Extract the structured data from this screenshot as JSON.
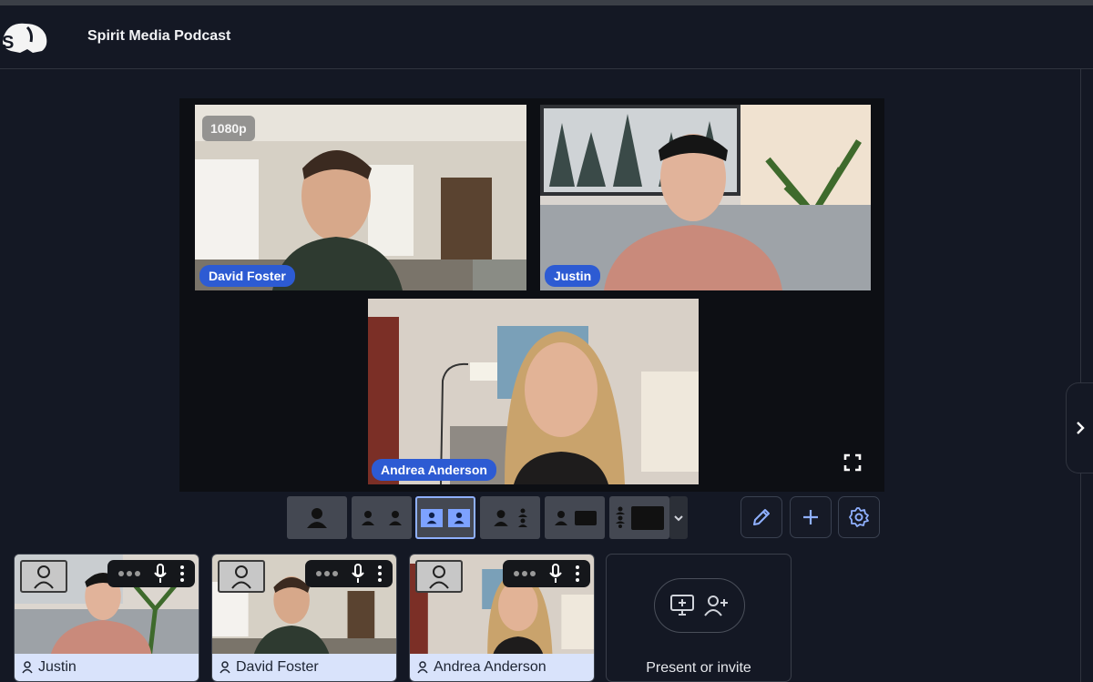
{
  "app": {
    "title": "Spirit Media Podcast",
    "logo_letter": "S"
  },
  "stage": {
    "resolution_badge": "1080p",
    "participants": [
      {
        "name": "David Foster"
      },
      {
        "name": "Justin"
      },
      {
        "name": "Andrea Anderson"
      }
    ]
  },
  "layout_options": [
    "single",
    "two-side-by-side",
    "two-side-by-side-selected",
    "one-plus-two",
    "one-plus-screen",
    "list-plus-screen"
  ],
  "selected_layout_index": 2,
  "thumbnails": [
    {
      "name": "Justin"
    },
    {
      "name": "David Foster"
    },
    {
      "name": "Andrea Anderson"
    }
  ],
  "invite": {
    "label": "Present or invite"
  },
  "colors": {
    "accent": "#2d5bd3",
    "background": "#141824",
    "name_strip": "#d9e3fb"
  },
  "icons": [
    "pencil-icon",
    "plus-icon",
    "gear-icon",
    "chevron-right-icon",
    "fullscreen-icon",
    "mic-icon",
    "more-icon",
    "screen-share-icon",
    "add-person-icon",
    "person-icon"
  ]
}
